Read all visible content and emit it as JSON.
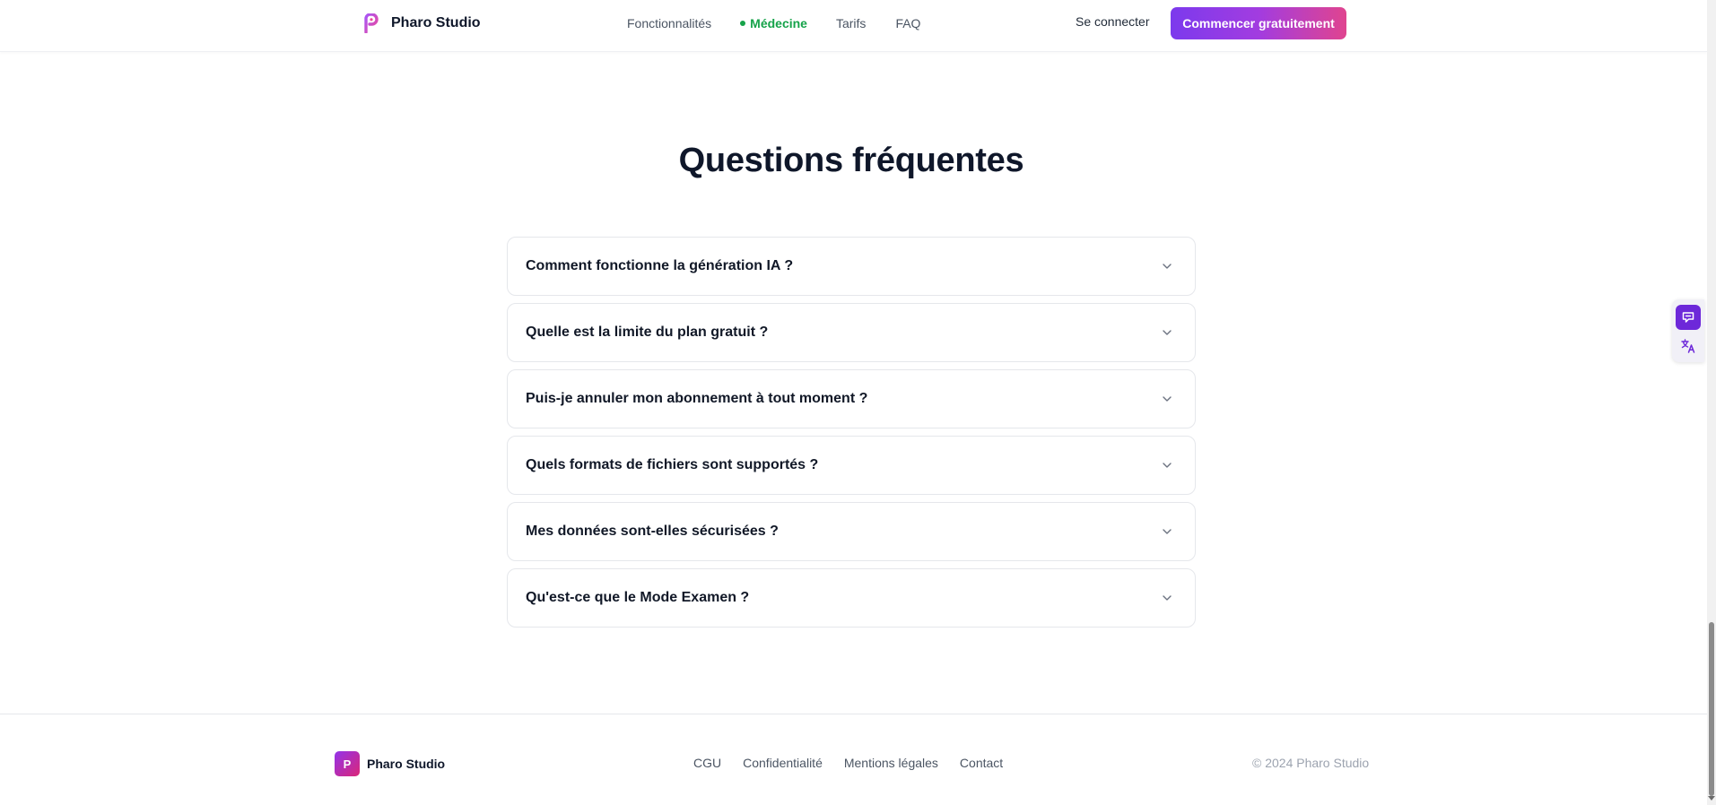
{
  "header": {
    "brand_name": "Pharo Studio",
    "nav": [
      {
        "label": "Fonctionnalités"
      },
      {
        "label": "Médecine",
        "active": true
      },
      {
        "label": "Tarifs"
      },
      {
        "label": "FAQ"
      }
    ],
    "login_label": "Se connecter",
    "cta_label": "Commencer gratuitement"
  },
  "faq": {
    "title": "Questions fréquentes",
    "items": [
      {
        "question": "Comment fonctionne la génération IA ?"
      },
      {
        "question": "Quelle est la limite du plan gratuit ?"
      },
      {
        "question": "Puis-je annuler mon abonnement à tout moment ?"
      },
      {
        "question": "Quels formats de fichiers sont supportés ?"
      },
      {
        "question": "Mes données sont-elles sécurisées ?"
      },
      {
        "question": "Qu'est-ce que le Mode Examen ?"
      }
    ]
  },
  "footer": {
    "badge_letter": "P",
    "brand_name": "Pharo Studio",
    "links": [
      {
        "label": "CGU"
      },
      {
        "label": "Confidentialité"
      },
      {
        "label": "Mentions légales"
      },
      {
        "label": "Contact"
      }
    ],
    "copyright": "© 2024 Pharo Studio"
  },
  "colors": {
    "accent_green": "#16a34a",
    "cta_gradient_start": "#7c3aed",
    "cta_gradient_end": "#e0448f",
    "widget_purple": "#6d28d9"
  },
  "icons": [
    "pharo-logo-icon",
    "chevron-down-icon",
    "message-icon",
    "translate-icon"
  ]
}
